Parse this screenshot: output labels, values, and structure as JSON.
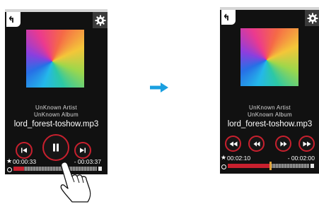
{
  "before": {
    "artist": "UnKnown Artist",
    "album": "UnKnown Album",
    "title": "lord_forest-toshow.mp3",
    "elapsed": "00:00:33",
    "remaining": "- 00:03:37",
    "progress": 0.13,
    "controls": [
      "prev-icon",
      "pause-icon",
      "next-icon"
    ]
  },
  "after": {
    "artist": "UnKnown Artist",
    "album": "UnKnown Album",
    "title": "lord_forest-toshow.mp3",
    "elapsed": "00:02:10",
    "remaining": "- 00:02:00",
    "progress": 0.52,
    "controls": [
      "rewind-fast-icon",
      "rewind-icon",
      "forward-icon",
      "forward-fast-icon"
    ]
  },
  "colors": {
    "accent": "#c8202e",
    "arrow": "#1a9fe0",
    "thumb": "#e0a33a"
  }
}
